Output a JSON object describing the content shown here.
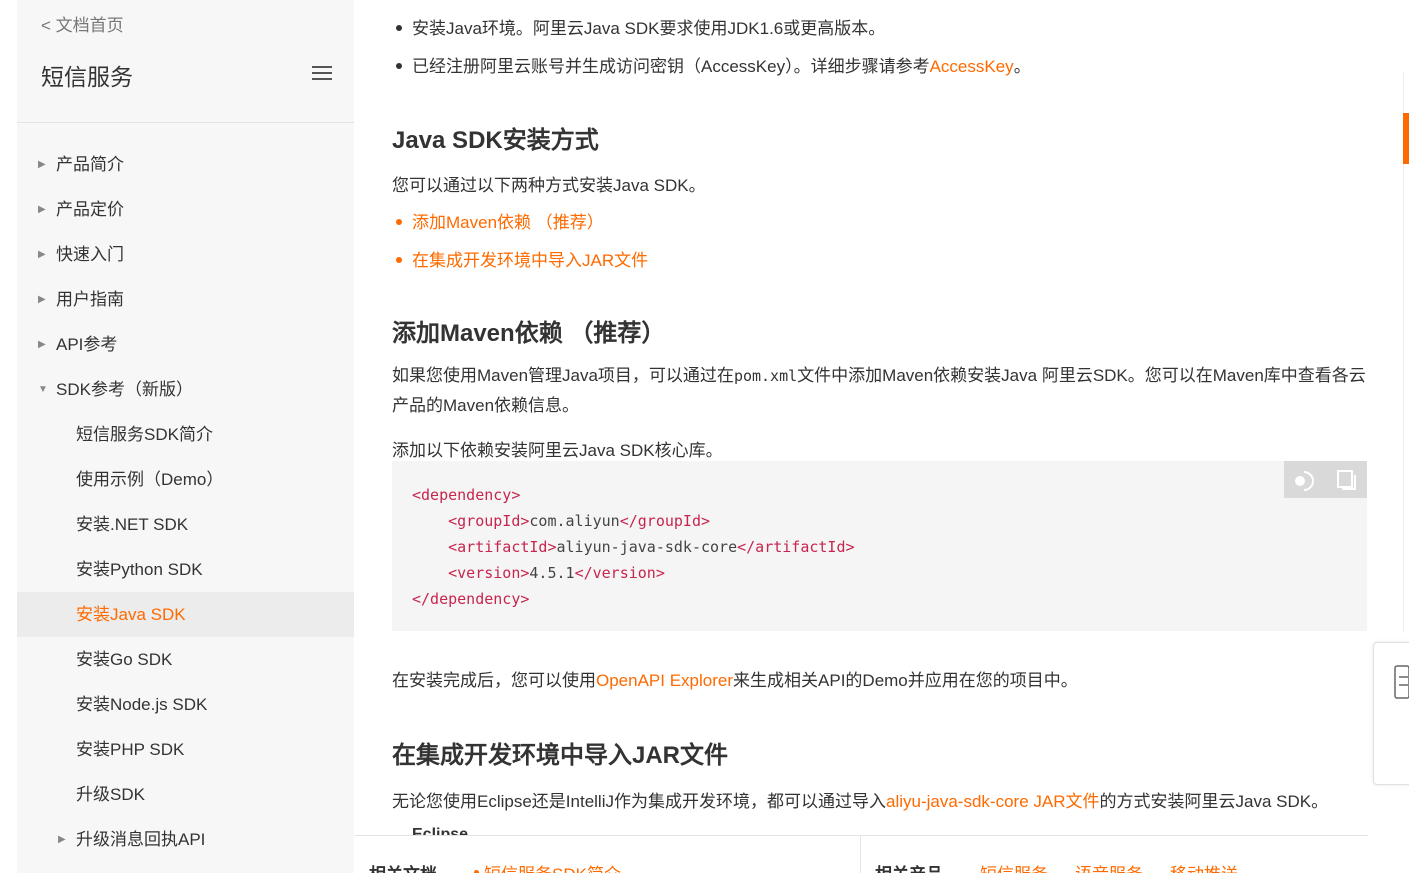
{
  "sidebar": {
    "back_link": "< 文档首页",
    "title": "短信服务",
    "items": [
      {
        "label": "产品简介",
        "level": 1,
        "expandable": true
      },
      {
        "label": "产品定价",
        "level": 1,
        "expandable": true
      },
      {
        "label": "快速入门",
        "level": 1,
        "expandable": true
      },
      {
        "label": "用户指南",
        "level": 1,
        "expandable": true
      },
      {
        "label": "API参考",
        "level": 1,
        "expandable": true
      },
      {
        "label": "SDK参考（新版）",
        "level": 1,
        "expanded": true
      },
      {
        "label": "短信服务SDK简介",
        "level": 2
      },
      {
        "label": "使用示例（Demo）",
        "level": 2
      },
      {
        "label": "安装.NET SDK",
        "level": 2
      },
      {
        "label": "安装Python SDK",
        "level": 2
      },
      {
        "label": "安装Java SDK",
        "level": 2,
        "active": true
      },
      {
        "label": "安装Go SDK",
        "level": 2
      },
      {
        "label": "安装Node.js SDK",
        "level": 2
      },
      {
        "label": "安装PHP SDK",
        "level": 2
      },
      {
        "label": "升级SDK",
        "level": 2
      },
      {
        "label": "升级消息回执API",
        "level": 2,
        "expandable": true
      }
    ]
  },
  "content": {
    "prereq_1": "安装Java环境。阿里云Java SDK要求使用JDK1.6或更高版本。",
    "prereq_2_text": "已经注册阿里云账号并生成访问密钥（AccessKey）。详细步骤请参考",
    "prereq_2_link": "AccessKey",
    "prereq_2_end": "。",
    "h_install": "Java SDK安装方式",
    "install_intro": "您可以通过以下两种方式安装Java SDK。",
    "install_link_1": "添加Maven依赖 （推荐）",
    "install_link_2": "在集成开发环境中导入JAR文件",
    "h_maven": "添加Maven依赖 （推荐）",
    "maven_p1_a": "如果您使用Maven管理Java项目，可以通过在",
    "maven_p1_code": "pom.xml",
    "maven_p1_b": "文件中添加Maven依赖安装Java 阿里云SDK。您可以在Maven库中查看各云产品的Maven依赖信息。",
    "maven_p2": "添加以下依赖安装阿里云Java SDK核心库。",
    "code": {
      "lines": [
        {
          "indent": "",
          "open": "<dependency>",
          "text": "",
          "close": ""
        },
        {
          "indent": "    ",
          "open": "<groupId>",
          "text": "com.aliyun",
          "close": "</groupId>"
        },
        {
          "indent": "    ",
          "open": "<artifactId>",
          "text": "aliyun-java-sdk-core",
          "close": "</artifactId>"
        },
        {
          "indent": "    ",
          "open": "<version>",
          "text": "4.5.1",
          "close": "</version>"
        },
        {
          "indent": "",
          "open": "</dependency>",
          "text": "",
          "close": ""
        }
      ]
    },
    "after_text_a": "在安装完成后，您可以使用",
    "after_link": "OpenAPI Explorer",
    "after_text_b": "来生成相关API的Demo并应用在您的项目中。",
    "h_jar": "在集成开发环境中导入JAR文件",
    "jar_text_a": "无论您使用Eclipse还是IntelliJ作为集成开发环境，都可以通过导入",
    "jar_link": "aliyu-java-sdk-core JAR文件",
    "jar_text_b": "的方式安装阿里云Java SDK。",
    "cutoff_text": "Eclipse"
  },
  "footer": {
    "docs_label": "相关文档",
    "docs_link": "短信服务SDK简介",
    "products_label": "相关产品",
    "products": [
      "短信服务",
      "语音服务",
      "移动推送"
    ]
  },
  "icons": {
    "toggle": "theme-toggle-icon",
    "copy": "copy-icon",
    "menu": "hamburger-menu-icon",
    "float": "document-list-icon"
  },
  "colors": {
    "accent": "#ff6a00",
    "sidebar_bg": "#f7f7f7",
    "code_bg": "#f5f5f5",
    "code_tag": "#c7254e"
  }
}
